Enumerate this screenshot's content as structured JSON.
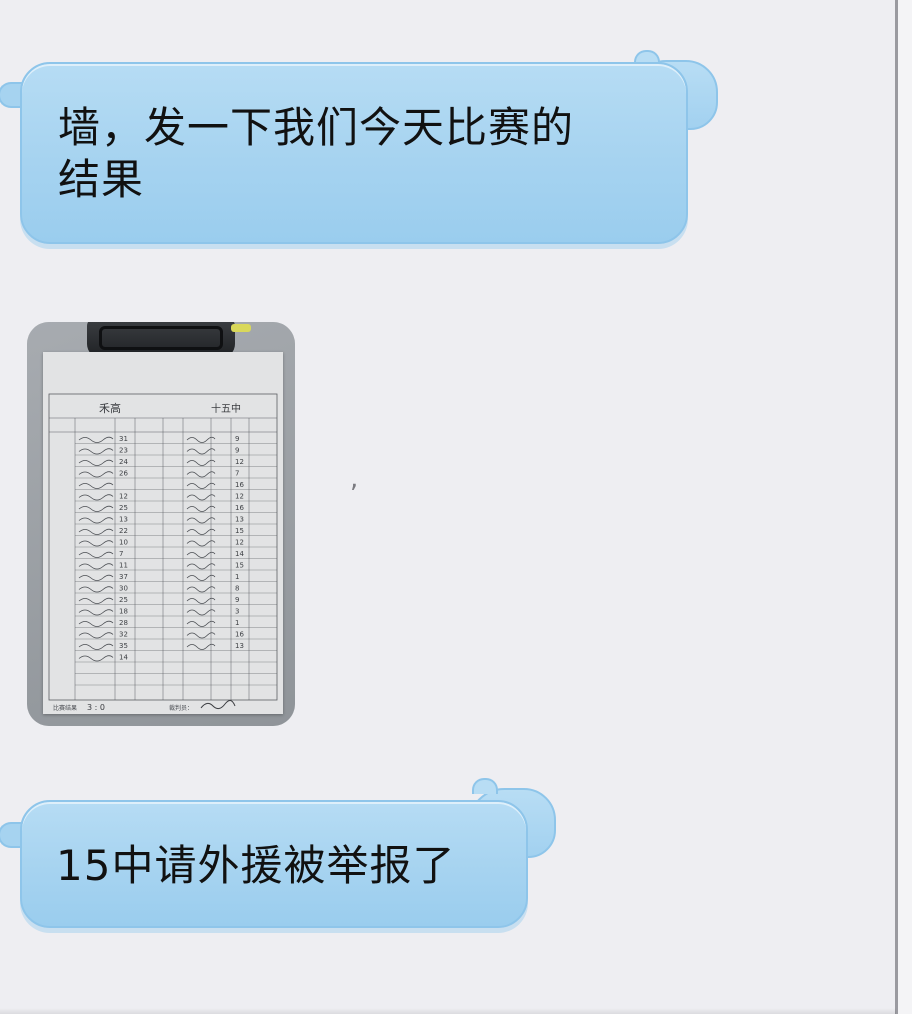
{
  "messages": [
    {
      "type": "text",
      "text_line1": "墙，发一下我们今天比赛的",
      "text_line2": "结果"
    },
    {
      "type": "image",
      "icon": "scoresheet-photo",
      "caption": ","
    },
    {
      "type": "text",
      "text": "15中请外援被举报了"
    }
  ],
  "scoresheet": {
    "home_team": "禾高",
    "away_team": "十五中",
    "home_scores": [
      "31",
      "23",
      "24",
      "26",
      "",
      "12",
      "25",
      "13",
      "22",
      "10",
      "7",
      "11",
      "37",
      "30",
      "25",
      "18",
      "28",
      "32",
      "35",
      "14"
    ],
    "away_scores": [
      "9",
      "9",
      "12",
      "7",
      "16",
      "12",
      "16",
      "13",
      "15",
      "12",
      "14",
      "15",
      "1",
      "8",
      "9",
      "3",
      "1",
      "16",
      "13"
    ],
    "final_label": "比赛结果",
    "final_score": "3 : 0",
    "signature_label": "裁判员："
  },
  "colors": {
    "bubble": "#a6d3f0",
    "bubble_border": "#8ec5ea",
    "background": "#eeeef2"
  }
}
